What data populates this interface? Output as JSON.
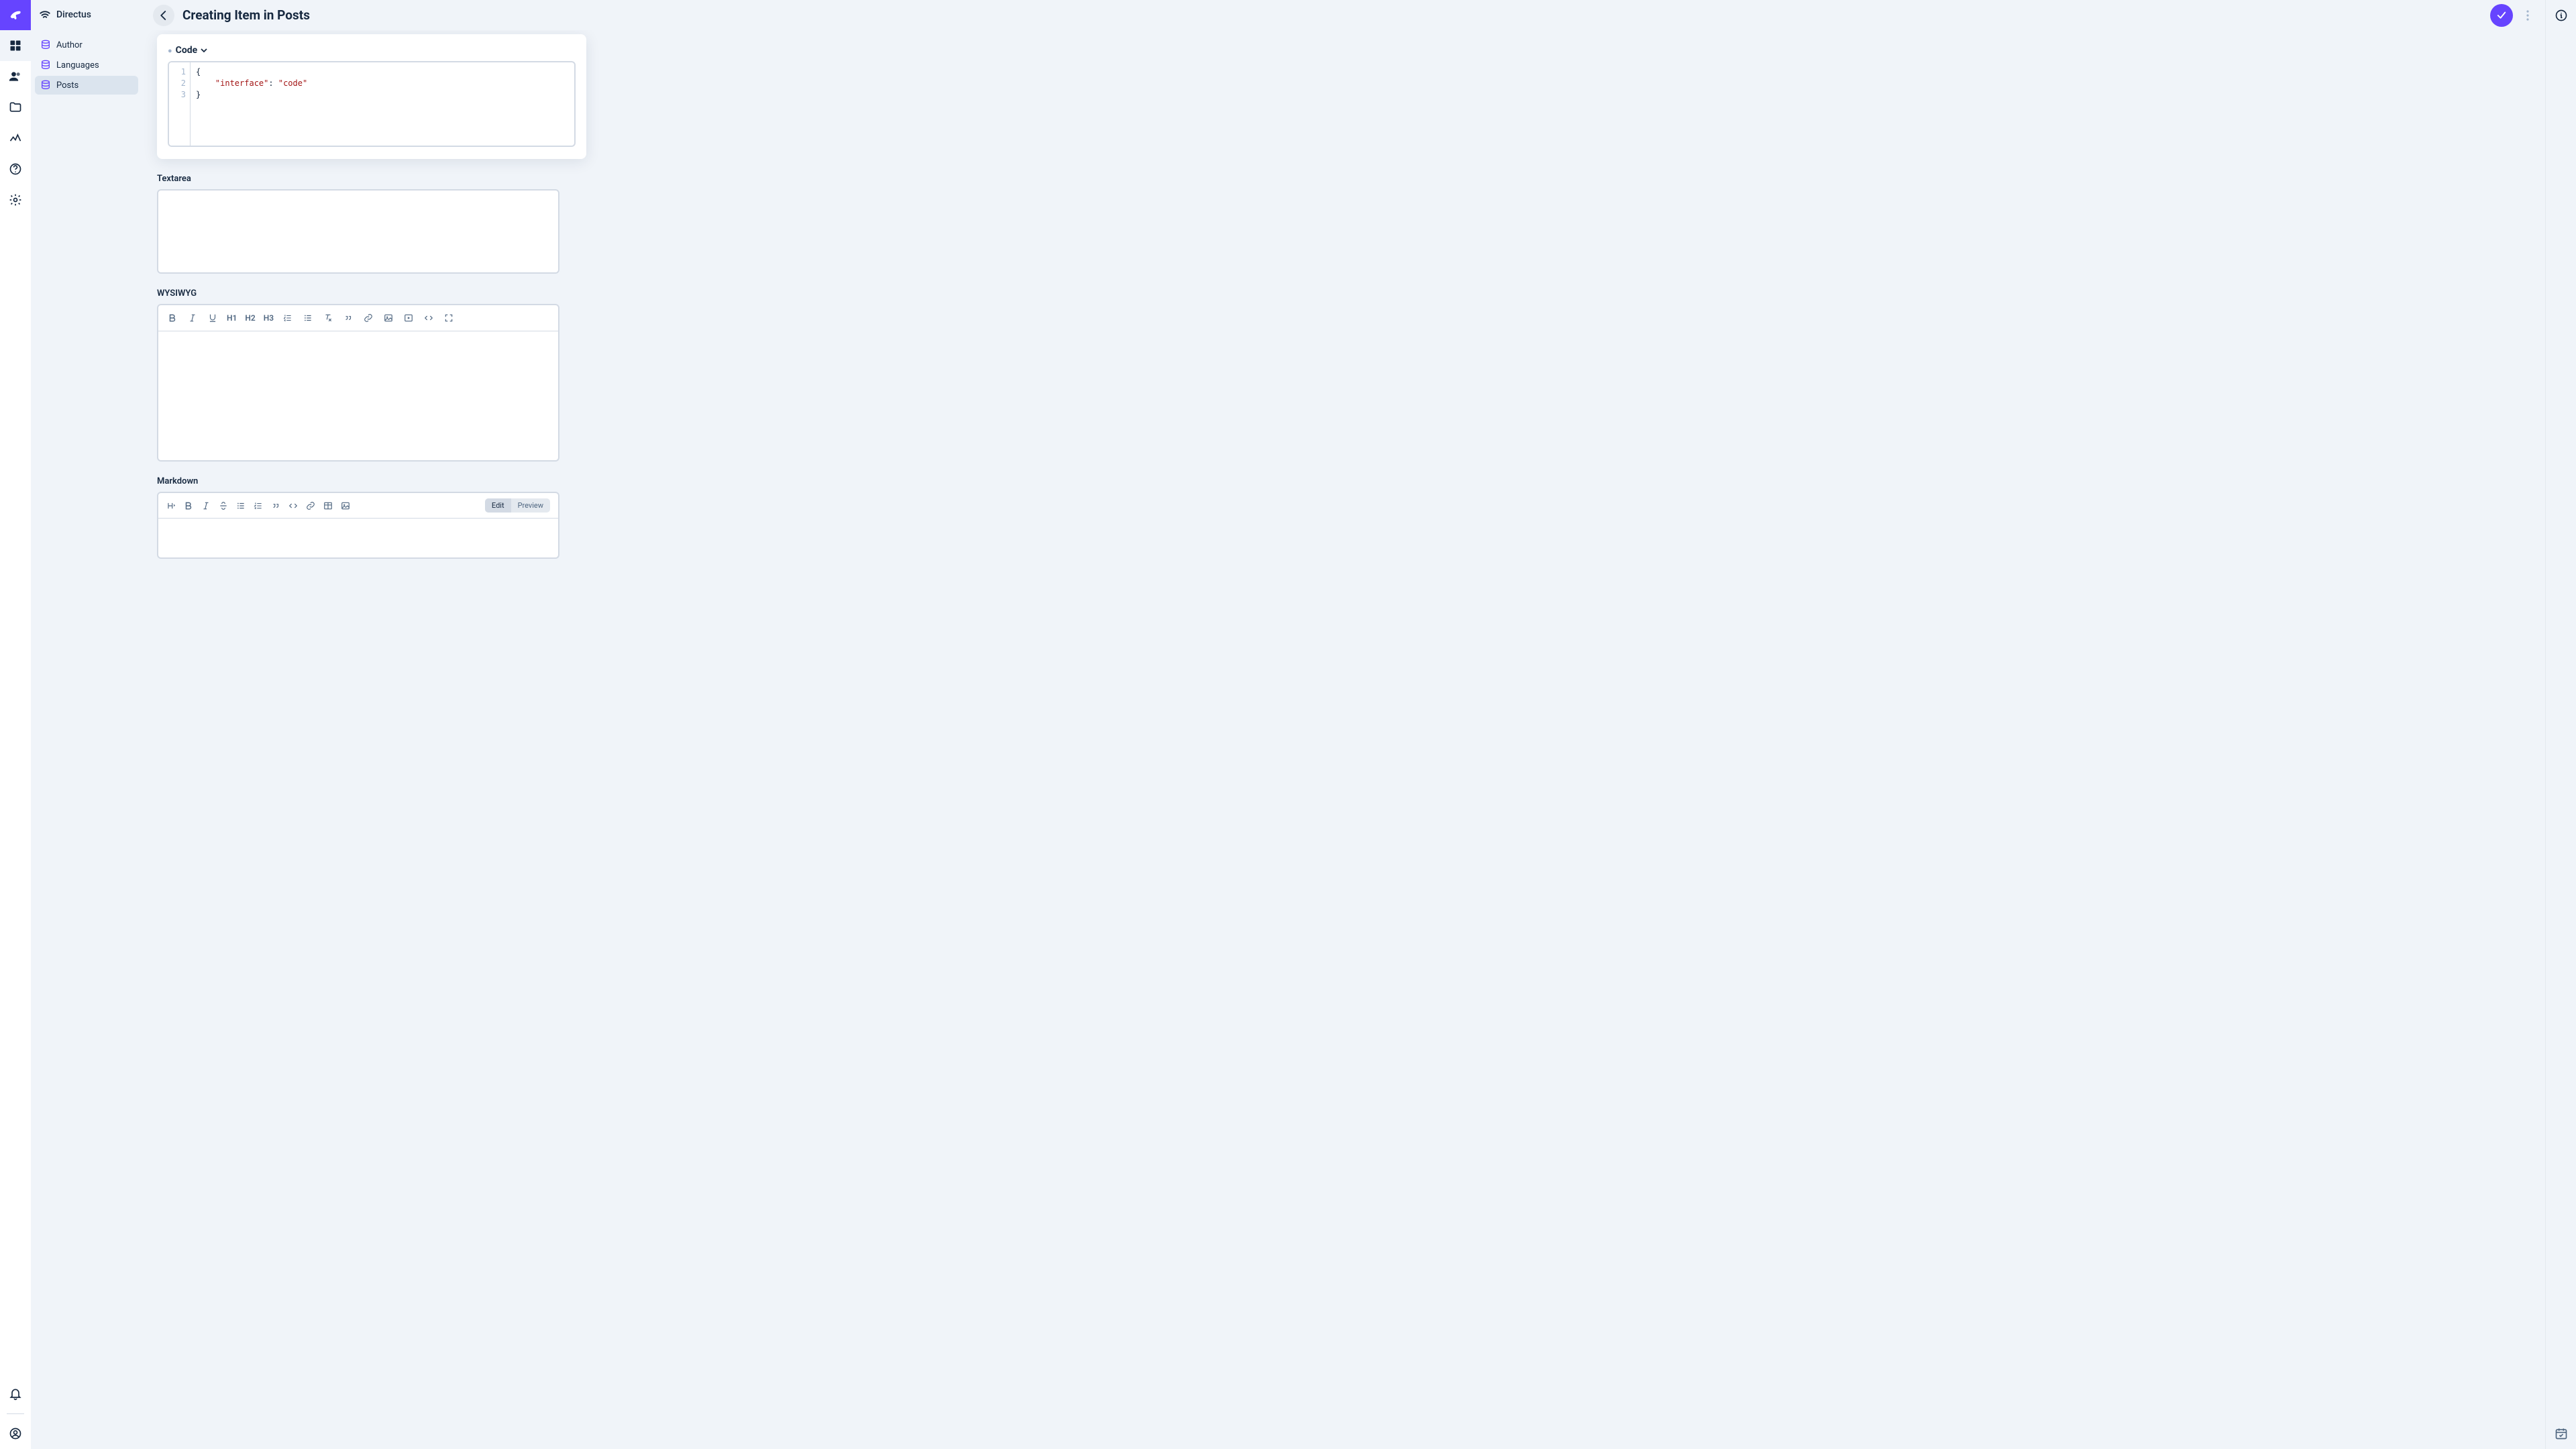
{
  "app": {
    "name": "Directus"
  },
  "rail_icons": [
    "collections-icon",
    "users-icon",
    "folder-icon",
    "insights-icon",
    "help-icon",
    "settings-icon",
    "notifications-icon",
    "account-icon"
  ],
  "sidebar": {
    "title": "Directus",
    "items": [
      {
        "label": "Author",
        "active": false
      },
      {
        "label": "Languages",
        "active": false
      },
      {
        "label": "Posts",
        "active": true
      }
    ]
  },
  "header": {
    "title": "Creating Item in Posts"
  },
  "fields": {
    "code": {
      "label": "Code",
      "gutter": [
        "1",
        "2",
        "3"
      ],
      "line1": "{",
      "line2_key": "\"interface\"",
      "line2_colon": ": ",
      "line2_val": "\"code\"",
      "line3": "}"
    },
    "textarea": {
      "label": "Textarea"
    },
    "wysiwyg": {
      "label": "WYSIWYG",
      "headings": {
        "h1": "H1",
        "h2": "H2",
        "h3": "H3"
      }
    },
    "markdown": {
      "label": "Markdown",
      "mode": {
        "edit": "Edit",
        "preview": "Preview"
      }
    }
  }
}
